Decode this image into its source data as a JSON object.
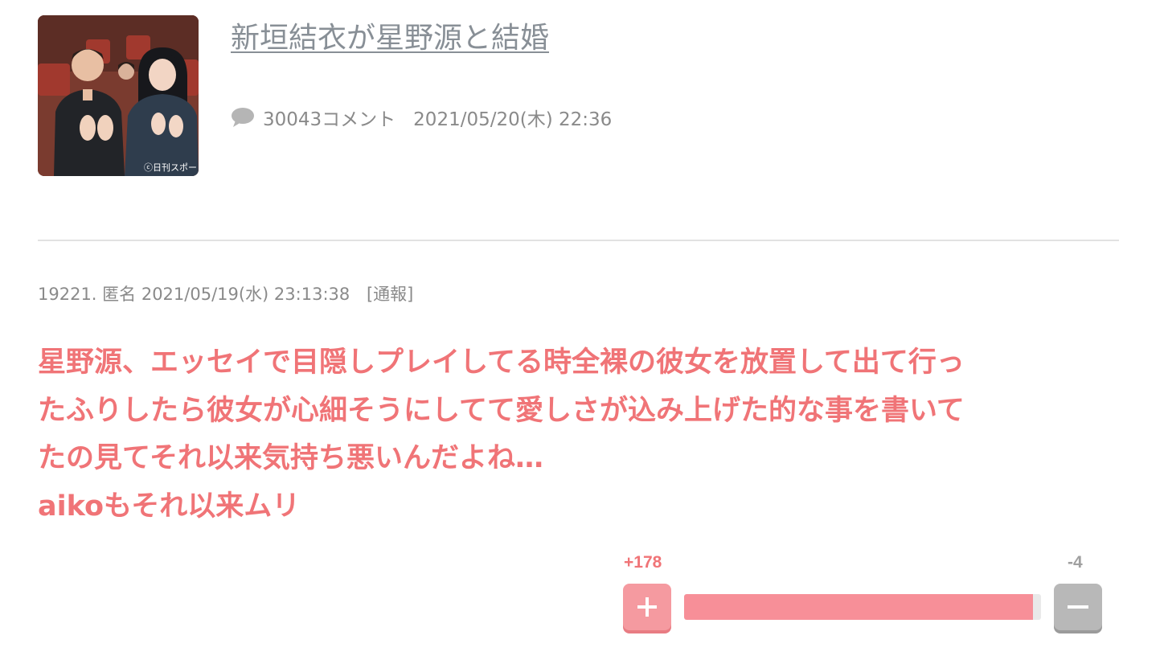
{
  "topic": {
    "thumbnail_credit": "ⓒ日刊スポー",
    "title": "新垣結衣が星野源と結婚",
    "comment_count_text": "30043コメント",
    "posted_at": "2021/05/20(木) 22:36",
    "comment_icon": "speech-bubble-icon"
  },
  "comment": {
    "header": "19221. 匿名 2021/05/19(水) 23:13:38",
    "report_label": "[通報]",
    "body_lines": [
      "星野源、エッセイで目隠しプレイしてる時全裸の彼女を放置して出て行っ",
      "たふりしたら彼女が心細そうにしてて愛しさが込み上げた的な事を書いて",
      "たの見てそれ以来気持ち悪いんだよね…",
      "aikoもそれ以来ムリ"
    ],
    "vote": {
      "plus_count": "+178",
      "minus_count": "-4",
      "plus_value": 178,
      "minus_value": 4,
      "plus_icon": "plus-icon",
      "minus_icon": "minus-icon"
    }
  },
  "colors": {
    "accent_pink": "#f07477",
    "plus_button": "#f59aa0",
    "bar_fill": "#f78f98",
    "minus_button": "#b8b8b8",
    "meta_gray": "#8a8a8a"
  }
}
